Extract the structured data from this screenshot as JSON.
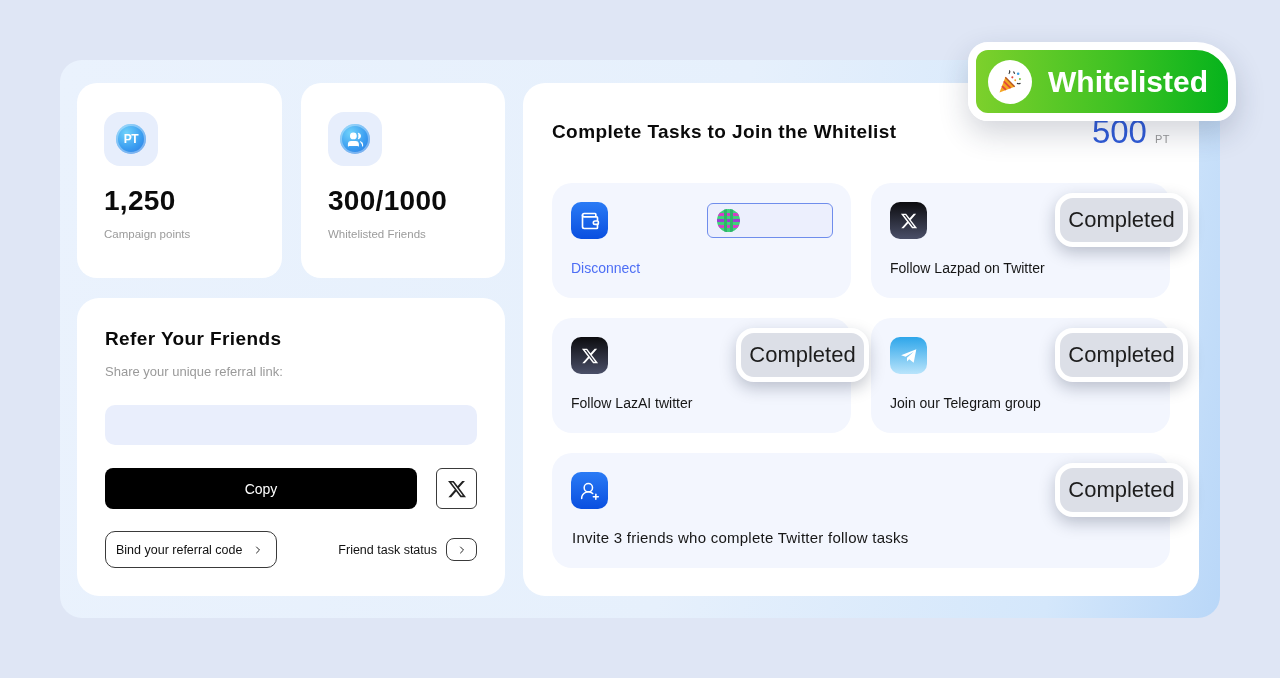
{
  "stats": [
    {
      "kind": "points",
      "icon_text": "PT",
      "value": "1,250",
      "label": "Campaign points"
    },
    {
      "kind": "friends",
      "value": "300/1000",
      "label": "Whitelisted Friends"
    }
  ],
  "referral": {
    "title": "Refer Your Friends",
    "subtitle": "Share your unique referral link:",
    "copy_button": "Copy",
    "bind_button": "Bind your referral code",
    "status_label": "Friend task status"
  },
  "tasks_panel": {
    "title": "Complete Tasks to Join the Whitelist",
    "reward": "500",
    "reward_unit": "PT",
    "wallet": {
      "action": "Disconnect"
    },
    "tasks": [
      {
        "kind": "twitter",
        "label": "Follow Lazpad on Twitter",
        "status": "Completed"
      },
      {
        "kind": "twitter",
        "label": "Follow LazAI twitter",
        "status": "Completed"
      },
      {
        "kind": "telegram",
        "label": "Join our Telegram group",
        "status": "Completed"
      },
      {
        "kind": "invite",
        "label": "Invite 3 friends who complete Twitter follow tasks",
        "status": "Completed"
      }
    ]
  },
  "whitelist_banner": {
    "label": "Whitelisted"
  }
}
